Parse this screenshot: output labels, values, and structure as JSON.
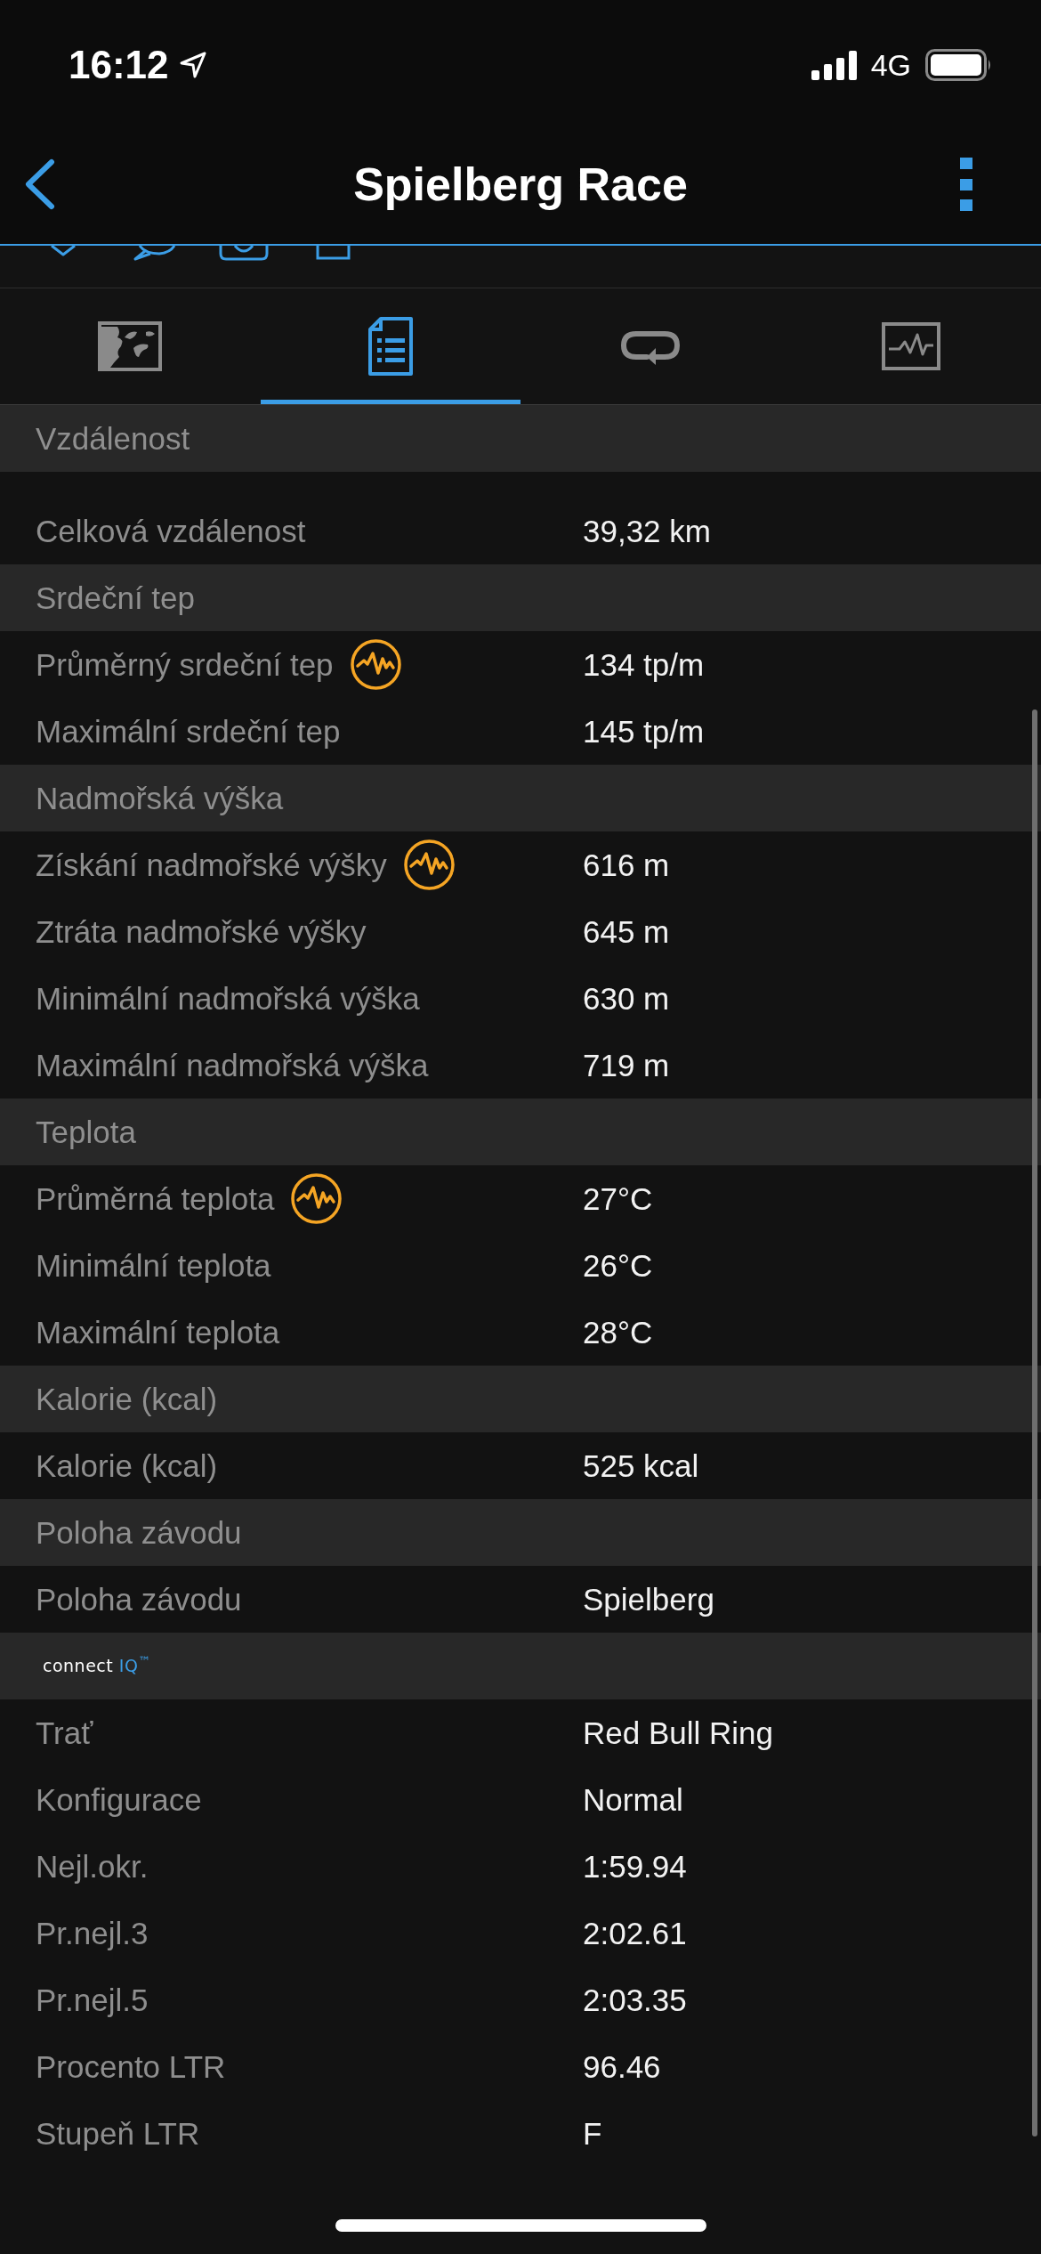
{
  "status_bar": {
    "time": "16:12",
    "network": "4G"
  },
  "header": {
    "title": "Spielberg Race"
  },
  "tabs": [
    {
      "kind": "map",
      "selected": false
    },
    {
      "kind": "details",
      "selected": true
    },
    {
      "kind": "laps",
      "selected": false
    },
    {
      "kind": "charts",
      "selected": false
    }
  ],
  "sections": [
    {
      "kind": "heading",
      "title": "Vzdálenost",
      "rows": [
        {
          "label": "Celková vzdálenost",
          "value": "39,32 km",
          "chart_link": false
        }
      ]
    },
    {
      "kind": "heading",
      "title": "Srdeční tep",
      "rows": [
        {
          "label": "Průměrný srdeční tep",
          "value": "134 tp/m",
          "chart_link": true
        },
        {
          "label": "Maximální srdeční tep",
          "value": "145 tp/m",
          "chart_link": false
        }
      ]
    },
    {
      "kind": "heading",
      "title": "Nadmořská výška",
      "rows": [
        {
          "label": "Získání nadmořské výšky",
          "value": "616 m",
          "chart_link": true
        },
        {
          "label": "Ztráta nadmořské výšky",
          "value": "645 m",
          "chart_link": false
        },
        {
          "label": "Minimální nadmořská výška",
          "value": "630 m",
          "chart_link": false
        },
        {
          "label": "Maximální nadmořská výška",
          "value": "719 m",
          "chart_link": false
        }
      ]
    },
    {
      "kind": "heading",
      "title": "Teplota",
      "rows": [
        {
          "label": "Průměrná teplota",
          "value": "27°C",
          "chart_link": true
        },
        {
          "label": "Minimální teplota",
          "value": "26°C",
          "chart_link": false
        },
        {
          "label": "Maximální teplota",
          "value": "28°C",
          "chart_link": false
        }
      ]
    },
    {
      "kind": "heading",
      "title": "Kalorie (kcal)",
      "rows": [
        {
          "label": "Kalorie (kcal)",
          "value": "525 kcal",
          "chart_link": false
        }
      ]
    },
    {
      "kind": "heading",
      "title": "Poloha závodu",
      "rows": [
        {
          "label": "Poloha závodu",
          "value": "Spielberg",
          "chart_link": false
        }
      ]
    },
    {
      "kind": "logo",
      "logo": {
        "word": "connect",
        "accent": "IQ$^{™}$"
      },
      "rows": [
        {
          "label": "Trať",
          "value": "Red Bull Ring",
          "chart_link": false
        },
        {
          "label": "Konfigurace",
          "value": "Normal",
          "chart_link": false
        },
        {
          "label": "Nejl.okr.",
          "value": "1:59.94",
          "chart_link": false
        },
        {
          "label": "Pr.nejl.3",
          "value": "2:02.61",
          "chart_link": false
        },
        {
          "label": "Pr.nejl.5",
          "value": "2:03.35",
          "chart_link": false
        },
        {
          "label": "Procento LTR",
          "value": "96.46",
          "chart_link": false
        },
        {
          "label": "Stupeň LTR",
          "value": "F",
          "chart_link": false
        }
      ]
    }
  ]
}
